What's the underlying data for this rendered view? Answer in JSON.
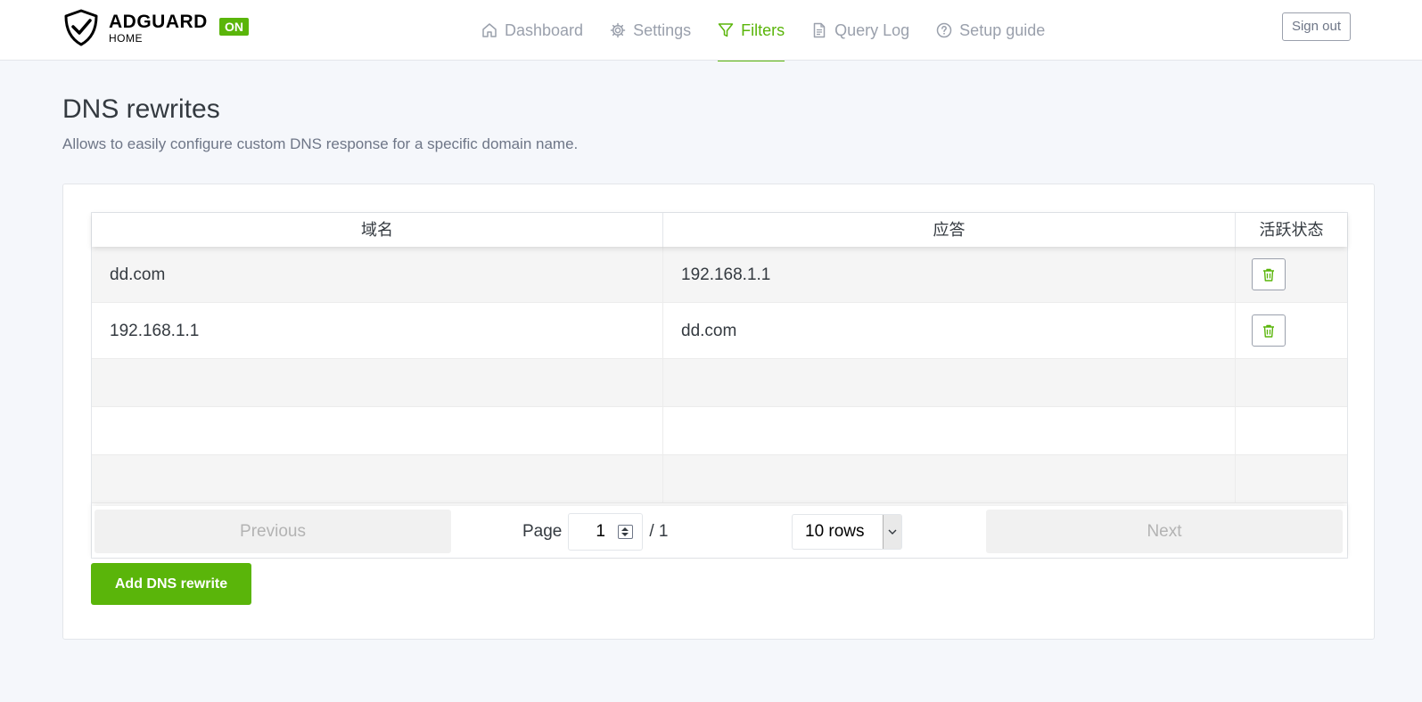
{
  "header": {
    "logo_title": "ADGUARD",
    "logo_subtitle": "HOME",
    "status_badge": "ON",
    "nav": [
      {
        "label": "Dashboard",
        "icon": "home-icon",
        "active": false
      },
      {
        "label": "Settings",
        "icon": "gear-icon",
        "active": false
      },
      {
        "label": "Filters",
        "icon": "filter-icon",
        "active": true
      },
      {
        "label": "Query Log",
        "icon": "document-icon",
        "active": false
      },
      {
        "label": "Setup guide",
        "icon": "help-circle-icon",
        "active": false
      }
    ],
    "signout_label": "Sign out"
  },
  "page": {
    "title": "DNS rewrites",
    "description": "Allows to easily configure custom DNS response for a specific domain name."
  },
  "table": {
    "columns": [
      "域名",
      "应答",
      "活跃状态"
    ],
    "rows": [
      {
        "domain": "dd.com",
        "answer": "192.168.1.1"
      },
      {
        "domain": "192.168.1.1",
        "answer": "dd.com"
      }
    ]
  },
  "pagination": {
    "previous_label": "Previous",
    "next_label": "Next",
    "page_label": "Page",
    "current_page": "1",
    "total_pages": "/ 1",
    "rows_option": "10 rows"
  },
  "actions": {
    "add_label": "Add DNS rewrite"
  },
  "colors": {
    "accent": "#5ab50a",
    "nav_inactive": "#9aa0ac",
    "background": "#f5f7fb"
  }
}
